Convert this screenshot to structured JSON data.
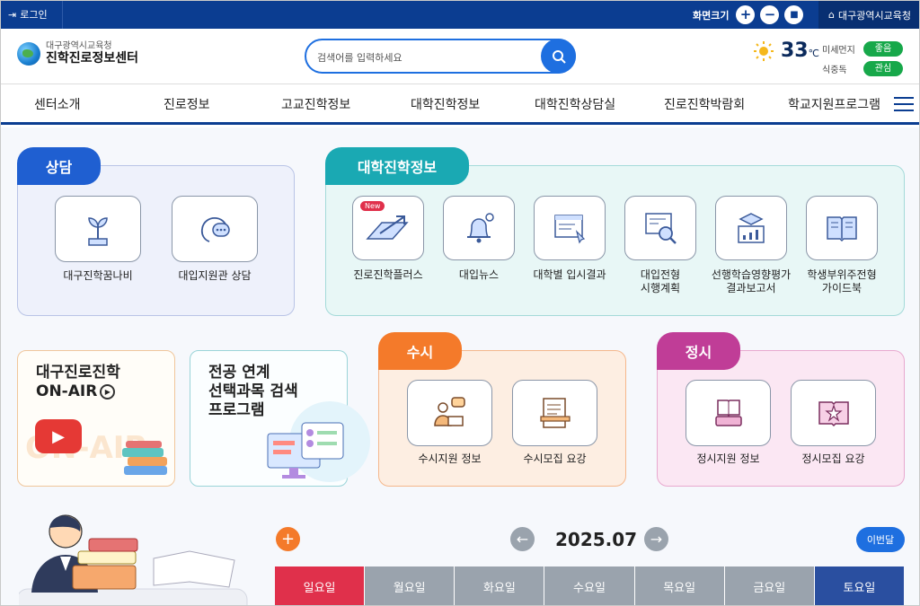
{
  "topbar": {
    "login": "로그인",
    "zoom_label": "화면크기",
    "zoom_in": "+",
    "zoom_out": "−",
    "zoom_reset": "■",
    "office": "대구광역시교육청"
  },
  "header": {
    "logo_top": "대구광역시교육청",
    "logo_bottom": "진학진로정보센터",
    "search_placeholder": "검색어를 입력하세요",
    "temperature": "33",
    "temp_unit": "℃",
    "fine_dust_label": "미세먼지",
    "fine_dust_value": "좋음",
    "food_poison_label": "식중독",
    "food_poison_value": "관심"
  },
  "nav": [
    "센터소개",
    "진로정보",
    "고교진학정보",
    "대학진학정보",
    "대학진학상담실",
    "진로진학박람회",
    "학교지원프로그램"
  ],
  "counsel": {
    "title": "상담",
    "items": [
      {
        "label": "대구진학꿈나비",
        "icon": "plant-icon"
      },
      {
        "label": "대입지원관 상담",
        "icon": "chat-head-icon"
      }
    ]
  },
  "univ_info": {
    "title": "대학진학정보",
    "new_badge": "New",
    "items": [
      {
        "label": "진로진학플러스",
        "icon": "arrow-plus-icon"
      },
      {
        "label": "대입뉴스",
        "icon": "bell-icon"
      },
      {
        "label": "대학별 입시결과",
        "icon": "chart-board-icon"
      },
      {
        "label": "대입전형",
        "label2": "시행계획",
        "icon": "magnifier-doc-icon"
      },
      {
        "label": "선행학습영향평가",
        "label2": "결과보고서",
        "icon": "graduation-chart-icon"
      },
      {
        "label": "학생부위주전형",
        "label2": "가이드북",
        "icon": "open-book-icon"
      }
    ]
  },
  "onair": {
    "line1": "대구진로진학",
    "line2": "ON-AIR",
    "bg_text": "ON-AIR"
  },
  "major": {
    "line1": "전공 연계",
    "line2": "선택과목 검색",
    "line3": "프로그램"
  },
  "susi": {
    "title": "수시",
    "items": [
      {
        "label": "수시지원 정보",
        "icon": "person-laptop-icon"
      },
      {
        "label": "수시모집 요강",
        "icon": "document-pen-icon"
      }
    ]
  },
  "jungsi": {
    "title": "정시",
    "items": [
      {
        "label": "정시지원 정보",
        "icon": "book-stack-icon"
      },
      {
        "label": "정시모집 요강",
        "icon": "star-book-icon"
      }
    ]
  },
  "calendar": {
    "add": "+",
    "prev": "←",
    "next": "→",
    "month": "2025.07",
    "this_month": "이번달",
    "days": [
      "일요일",
      "월요일",
      "화요일",
      "수요일",
      "목요일",
      "금요일",
      "토요일"
    ]
  },
  "colors": {
    "navy": "#0b3d91",
    "blue": "#1e6fe0",
    "teal": "#1aa9b3",
    "orange": "#f47a2a",
    "magenta": "#c03d97",
    "sunday": "#e0304b",
    "saturday": "#2a4fa0",
    "weekday": "#9aa3ad"
  }
}
